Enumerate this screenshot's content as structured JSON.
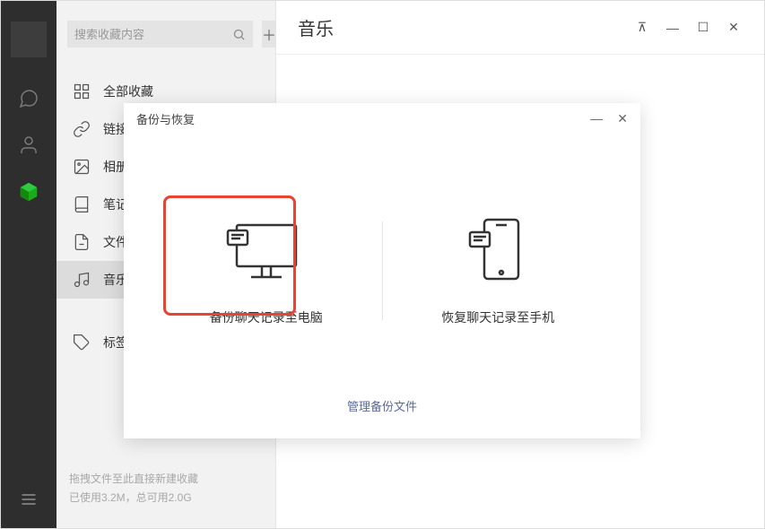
{
  "search": {
    "placeholder": "搜索收藏内容"
  },
  "nav": [
    {
      "key": "all",
      "label": "全部收藏"
    },
    {
      "key": "link",
      "label": "链接"
    },
    {
      "key": "album",
      "label": "相册"
    },
    {
      "key": "note",
      "label": "笔记"
    },
    {
      "key": "file",
      "label": "文件"
    },
    {
      "key": "music",
      "label": "音乐"
    },
    {
      "key": "tag",
      "label": "标签"
    }
  ],
  "page_title": "音乐",
  "footer": {
    "line1": "拖拽文件至此直接新建收藏",
    "line2": "已使用3.2M，总可用2.0G"
  },
  "dialog": {
    "title": "备份与恢复",
    "backup_label": "备份聊天记录至电脑",
    "restore_label": "恢复聊天记录至手机",
    "manage_link": "管理备份文件"
  }
}
